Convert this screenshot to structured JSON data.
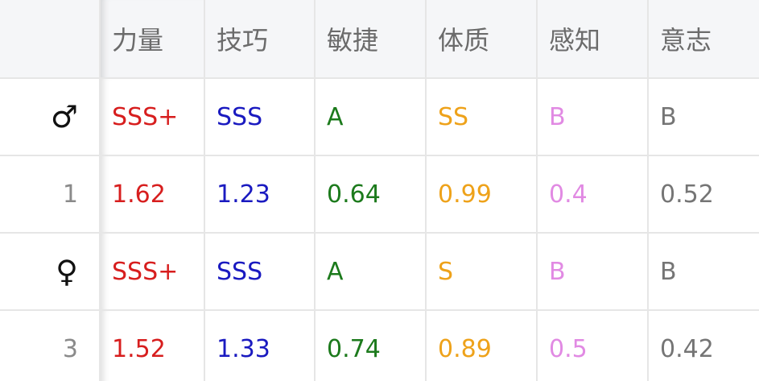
{
  "header": {
    "corner": "",
    "columns": [
      "力量",
      "技巧",
      "敏捷",
      "体质",
      "感知",
      "意志"
    ]
  },
  "colors": {
    "col1": "#d71e1e",
    "col2": "#1a1ac0",
    "col3": "#1c7a1c",
    "col4": "#eea21a",
    "col5": "#e18ae3",
    "col6": "#757575"
  },
  "rows": [
    {
      "label": "♂",
      "label_icon": "male-symbol-icon",
      "values": [
        "SSS+",
        "SSS",
        "A",
        "SS",
        "B",
        "B"
      ]
    },
    {
      "label": "1",
      "values": [
        "1.62",
        "1.23",
        "0.64",
        "0.99",
        "0.4",
        "0.52"
      ]
    },
    {
      "label": "♀",
      "label_icon": "female-symbol-icon",
      "values": [
        "SSS+",
        "SSS",
        "A",
        "S",
        "B",
        "B"
      ]
    },
    {
      "label": "3",
      "values": [
        "1.52",
        "1.33",
        "0.74",
        "0.89",
        "0.5",
        "0.42"
      ]
    }
  ]
}
